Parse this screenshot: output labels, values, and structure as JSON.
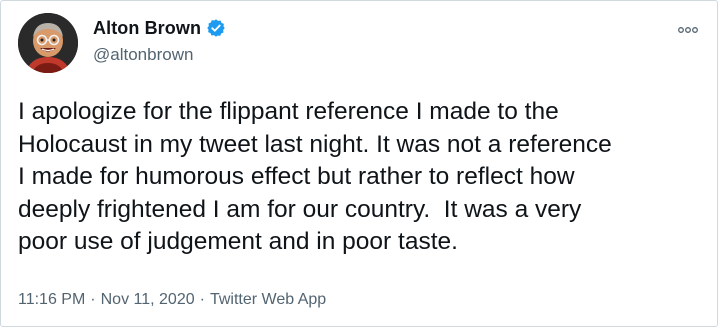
{
  "tweet": {
    "author": {
      "display_name": "Alton Brown",
      "handle": "@altonbrown",
      "verified": true
    },
    "text": "I apologize for the flippant reference I made to the\nHolocaust in my tweet last night. It was not a reference\nI made for humorous effect but rather to reflect how\ndeeply frightened I am for our country.  It was a very\npoor use of judgement and in poor taste.",
    "time": "11:16 PM",
    "separator": "·",
    "date": "Nov 11, 2020",
    "source": "Twitter Web App"
  },
  "icons": {
    "verified": "verified-badge-icon",
    "more": "more-options-icon"
  },
  "colors": {
    "verified_badge": "#1d9bf0",
    "secondary_text": "#536471",
    "primary_text": "#0f1419",
    "border": "#cfd9de"
  }
}
